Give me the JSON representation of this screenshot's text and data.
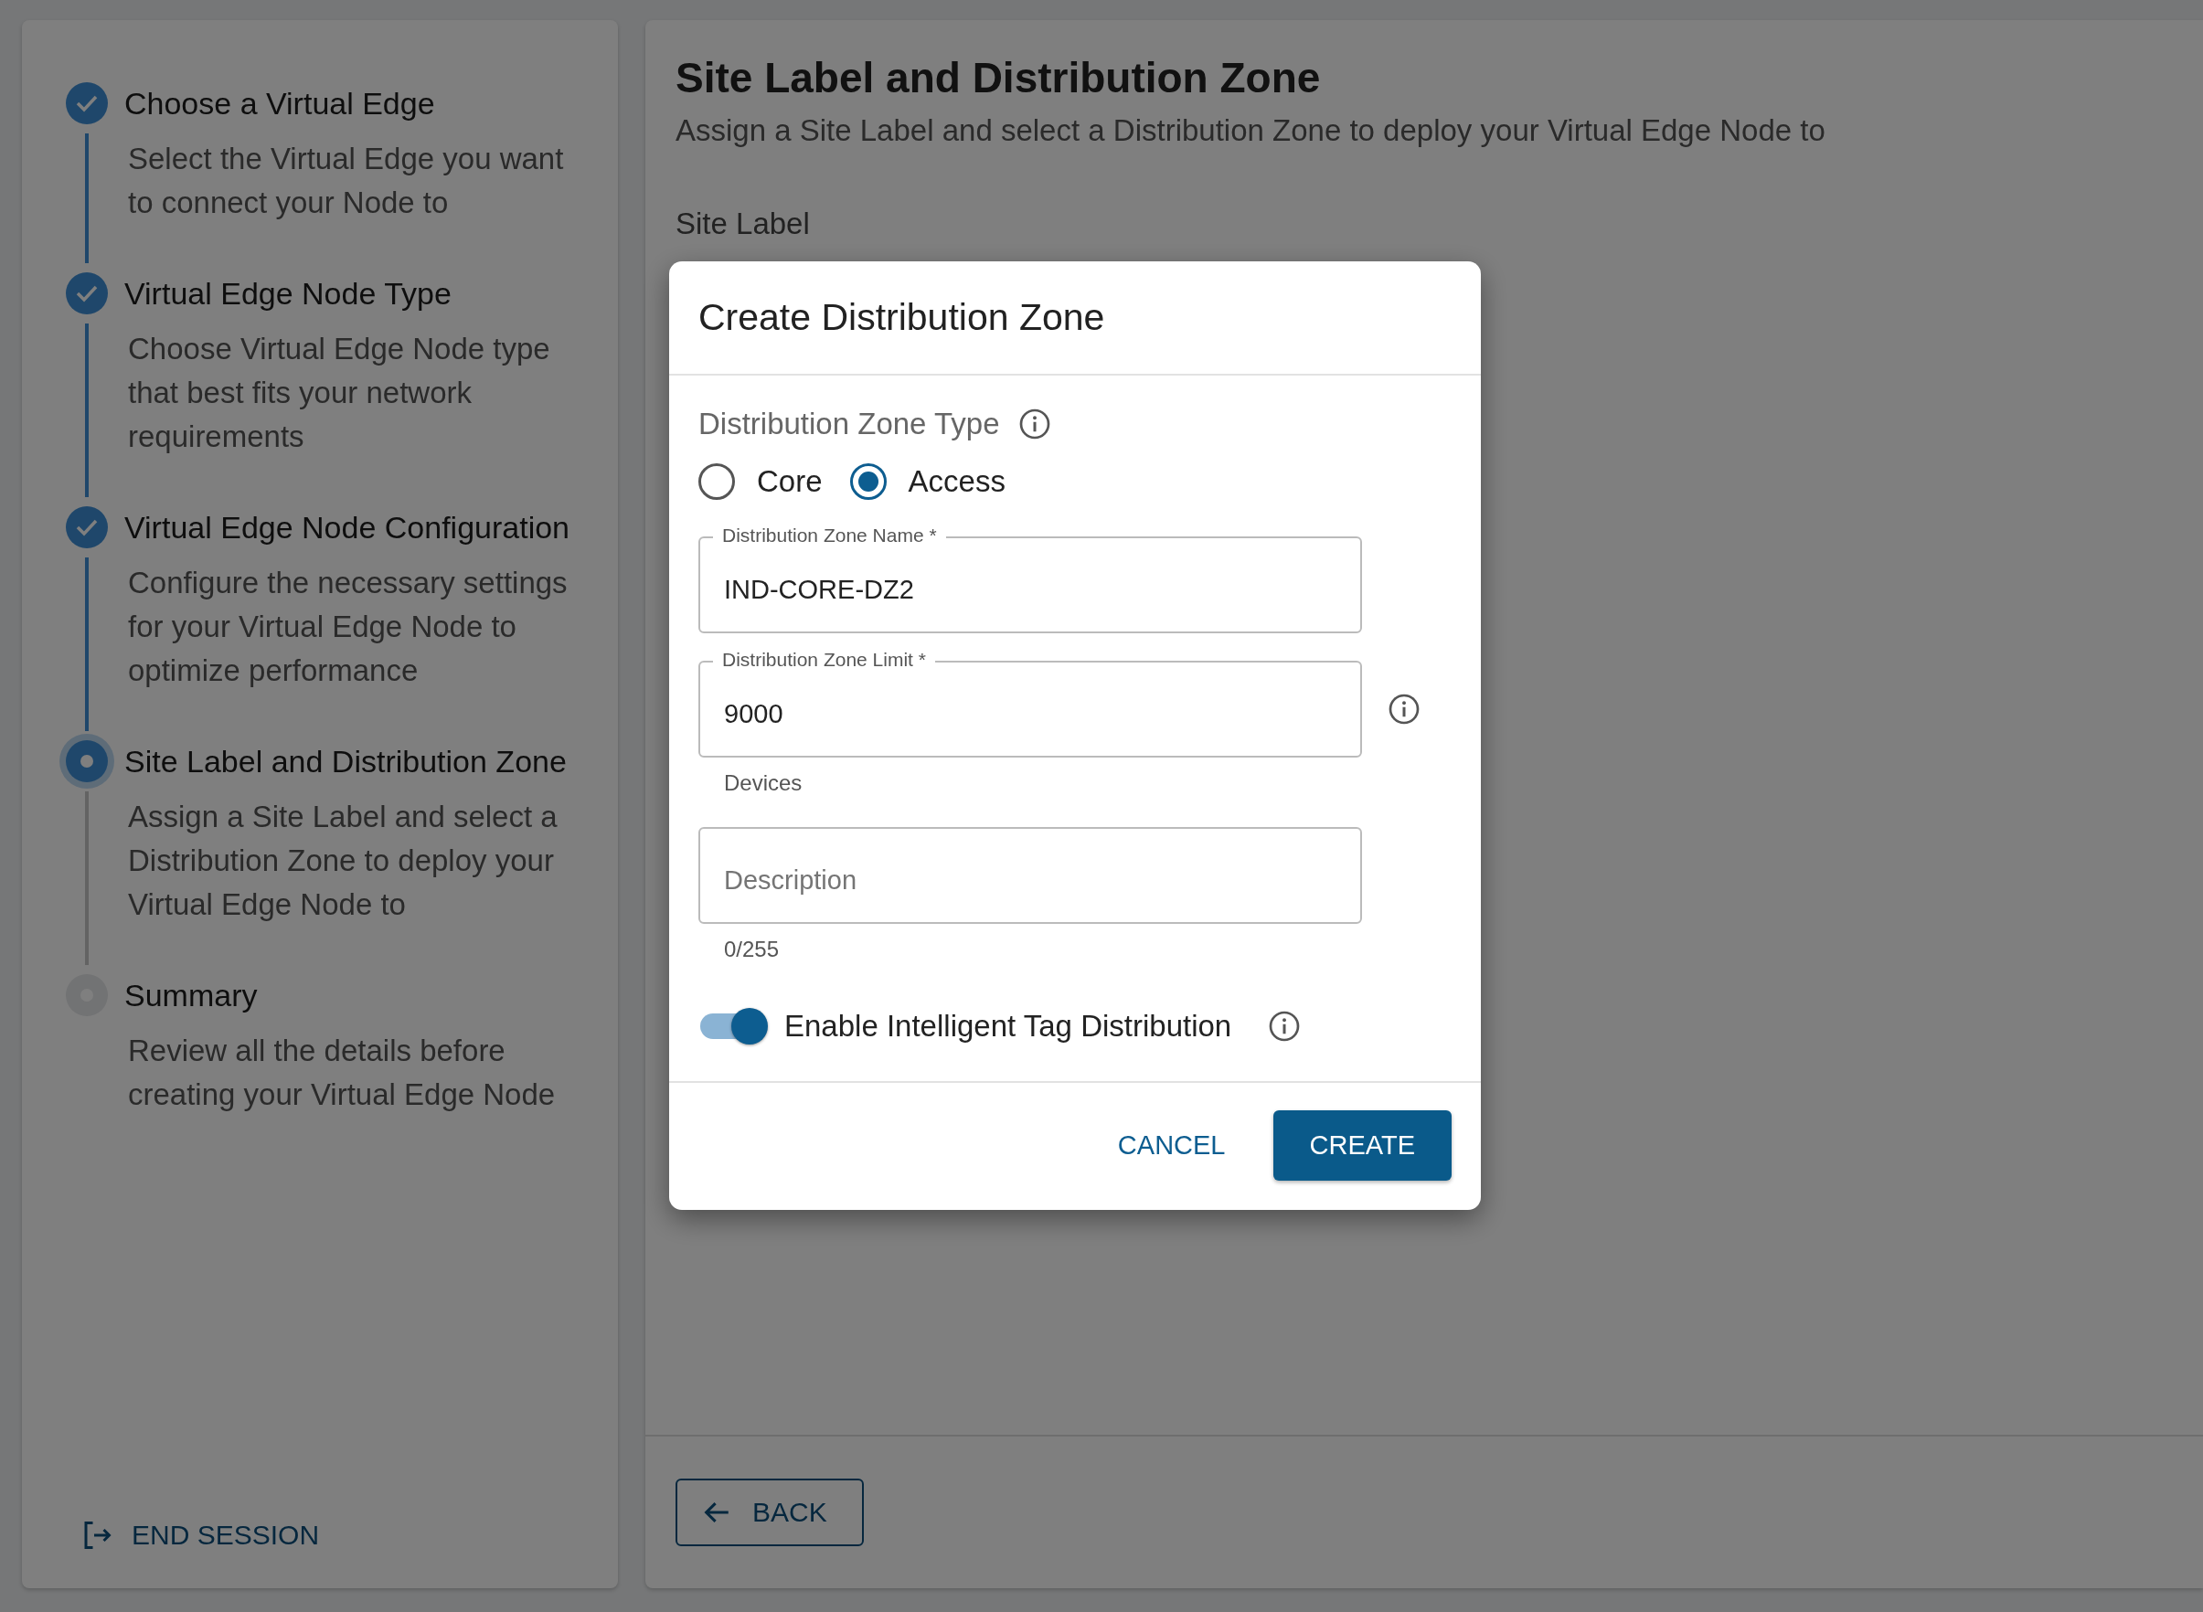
{
  "sidebar": {
    "steps": [
      {
        "title": "Choose a Virtual Edge",
        "description": "Select the Virtual Edge you want to connect your Node to",
        "completed": true,
        "current": false
      },
      {
        "title": "Virtual Edge Node Type",
        "description": "Choose Virtual Edge Node type that best fits your network requirements",
        "completed": true,
        "current": false
      },
      {
        "title": "Virtual Edge Node Configuration",
        "description": "Configure the necessary settings for your Virtual Edge Node to optimize performance",
        "completed": true,
        "current": false
      },
      {
        "title": "Site Label and Distribution Zone",
        "description": "Assign a Site Label and select a Distribution Zone to deploy your Virtual Edge Node to",
        "completed": false,
        "current": true
      },
      {
        "title": "Summary",
        "description": "Review all the details before creating your Virtual Edge Node",
        "completed": false,
        "current": false
      }
    ],
    "end_session": "END SESSION"
  },
  "main": {
    "title": "Site Label and Distribution Zone",
    "subtitle": "Assign a Site Label and select a Distribution Zone to deploy your Virtual Edge Node to",
    "site_label": "Site Label",
    "back_button": "BACK"
  },
  "dialog": {
    "title": "Create Distribution Zone",
    "zone_type": {
      "label": "Distribution Zone Type",
      "options": [
        {
          "label": "Core",
          "selected": false
        },
        {
          "label": "Access",
          "selected": true
        }
      ]
    },
    "name_field": {
      "label": "Distribution Zone Name *",
      "value": "IND-CORE-DZ2"
    },
    "limit_field": {
      "label": "Distribution Zone Limit *",
      "value": "9000",
      "helper": "Devices"
    },
    "description_field": {
      "placeholder": "Description",
      "counter": "0/255"
    },
    "toggle": {
      "label": "Enable Intelligent Tag Distribution",
      "on": true
    },
    "cancel_button": "CANCEL",
    "create_button": "CREATE"
  }
}
